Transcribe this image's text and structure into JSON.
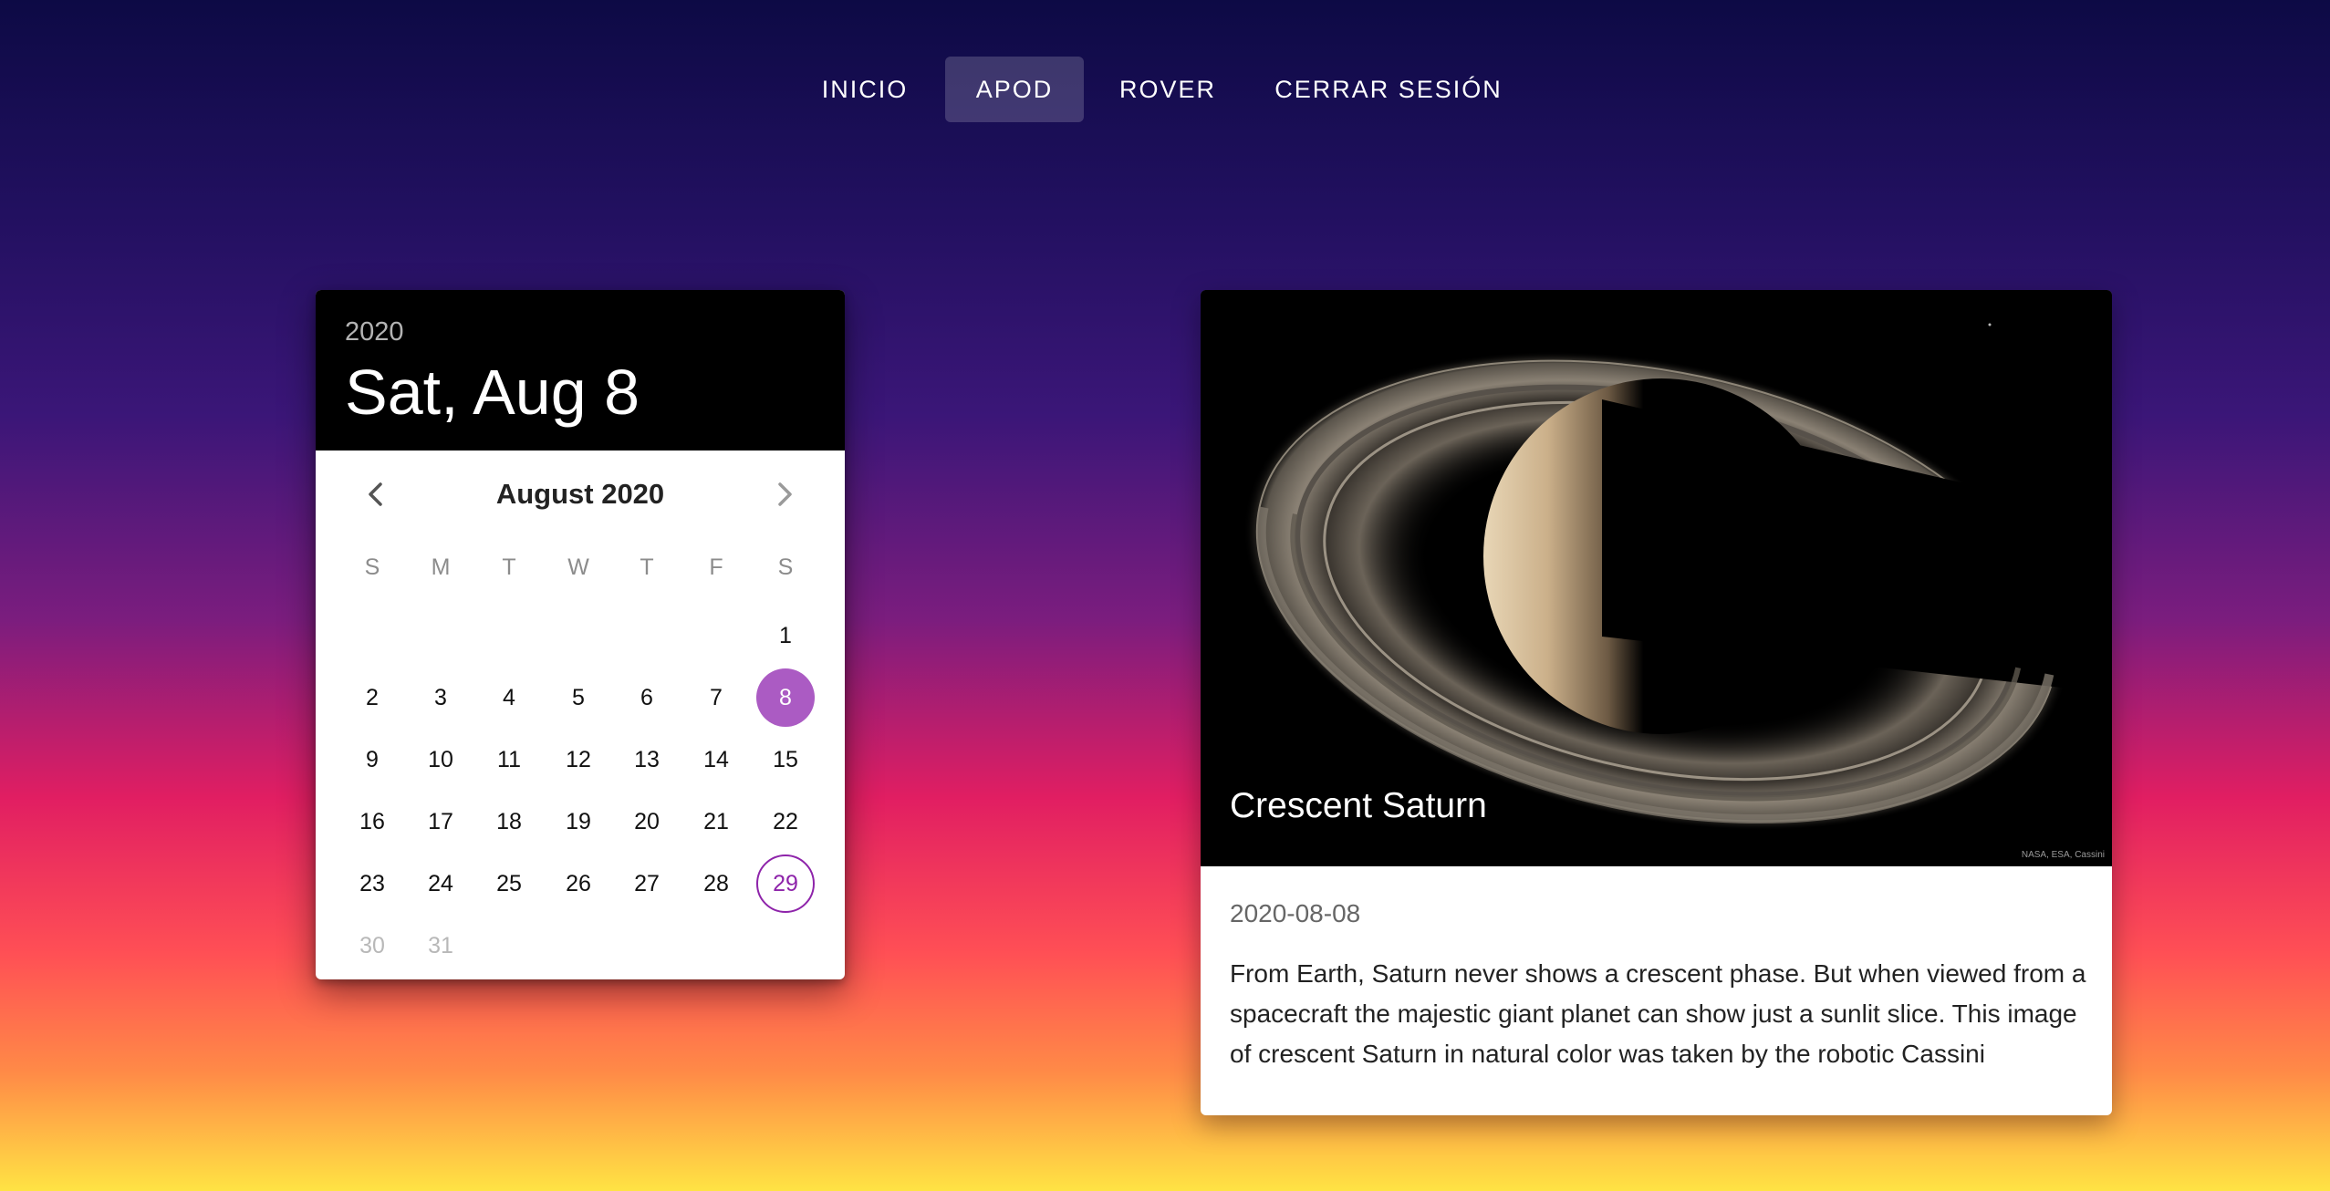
{
  "nav": {
    "items": [
      {
        "label": "INICIO"
      },
      {
        "label": "APOD",
        "active": true
      },
      {
        "label": "ROVER"
      },
      {
        "label": "CERRAR SESIÓN"
      }
    ]
  },
  "datepicker": {
    "year": "2020",
    "selected_display": "Sat, Aug 8",
    "month_label": "August 2020",
    "prev_icon": "chevron-left-icon",
    "next_icon": "chevron-right-icon",
    "weekdays": [
      "S",
      "M",
      "T",
      "W",
      "T",
      "F",
      "S"
    ],
    "selected_day": "8",
    "today_day": "29",
    "disabled_days": [
      "30",
      "31"
    ],
    "weeks": [
      [
        "",
        "",
        "",
        "",
        "",
        "",
        "1"
      ],
      [
        "2",
        "3",
        "4",
        "5",
        "6",
        "7",
        "8"
      ],
      [
        "9",
        "10",
        "11",
        "12",
        "13",
        "14",
        "15"
      ],
      [
        "16",
        "17",
        "18",
        "19",
        "20",
        "21",
        "22"
      ],
      [
        "23",
        "24",
        "25",
        "26",
        "27",
        "28",
        "29"
      ],
      [
        "30",
        "31",
        "",
        "",
        "",
        "",
        ""
      ]
    ],
    "accent_color": "#ab5bc3",
    "today_color": "#8e24aa"
  },
  "apod": {
    "title": "Crescent Saturn",
    "credit": "NASA, ESA, Cassini",
    "date": "2020-08-08",
    "explanation": "From Earth, Saturn never shows a crescent phase. But when viewed from a spacecraft the majestic giant planet can show just a sunlit slice. This image of crescent Saturn in natural color was taken by the robotic Cassini"
  }
}
